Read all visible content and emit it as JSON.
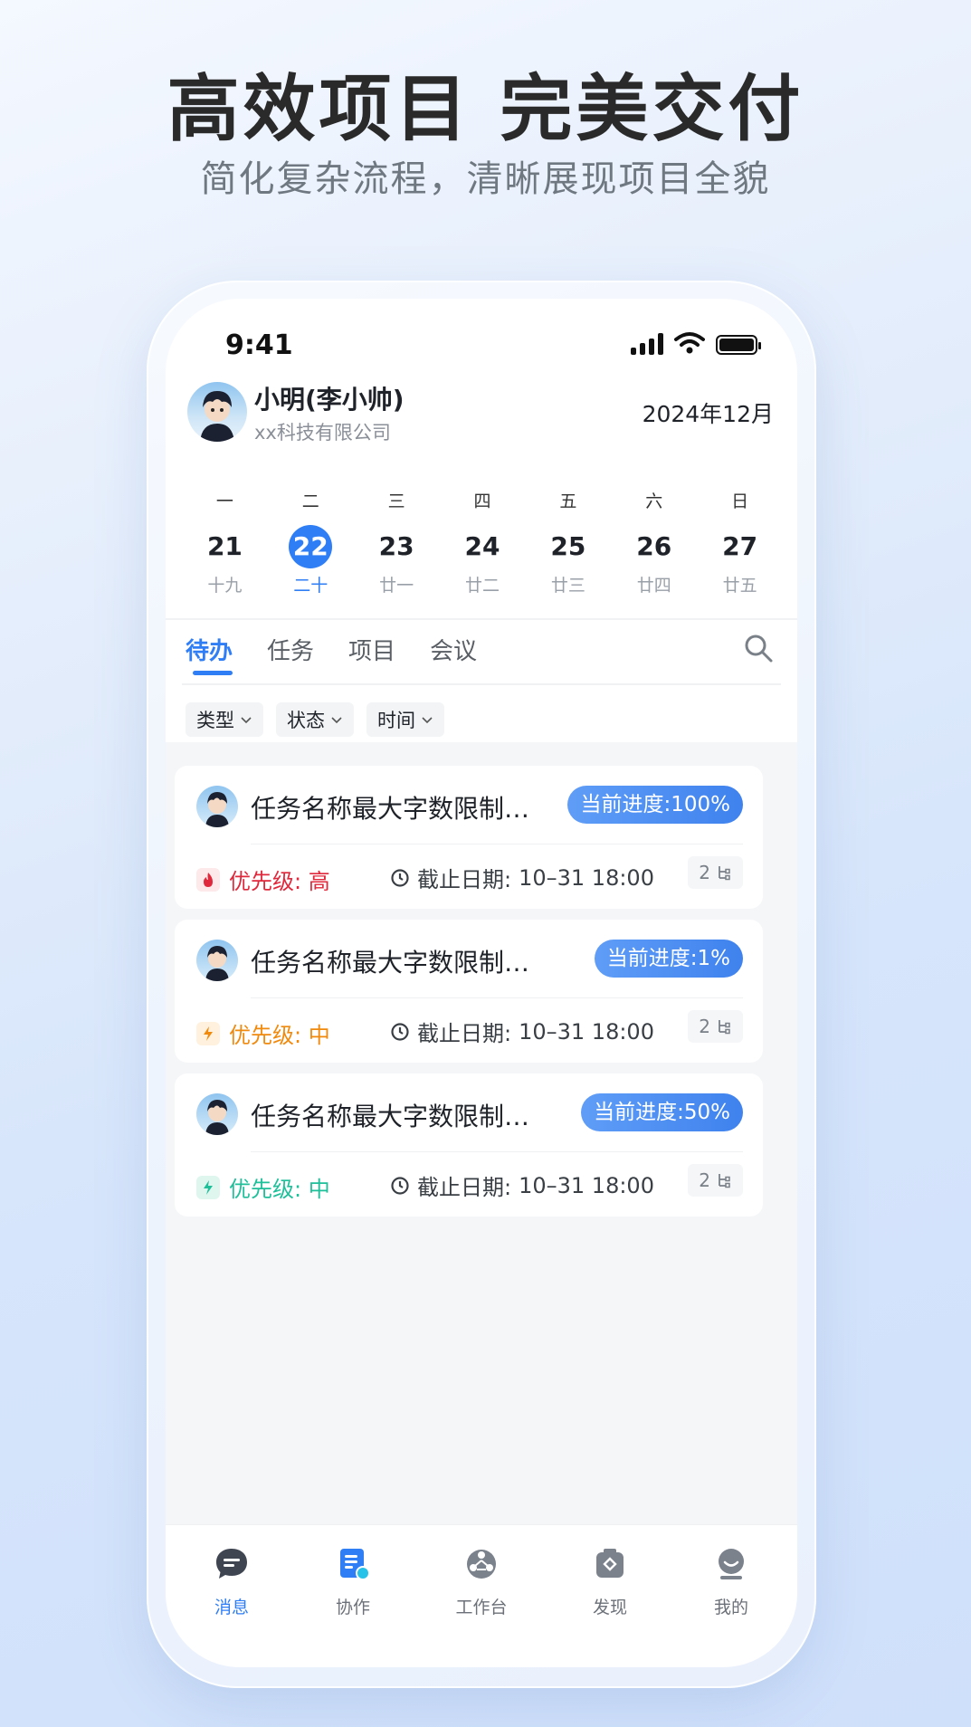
{
  "hero": {
    "title": "高效项目 完美交付",
    "subtitle": "简化复杂流程，清晰展现项目全貌"
  },
  "status_bar": {
    "time": "9:41"
  },
  "header": {
    "user_name": "小明(李小帅)",
    "company": "xx科技有限公司",
    "month": "2024年12月"
  },
  "calendar": {
    "days": [
      {
        "weekday": "一",
        "date": "21",
        "lunar": "十九",
        "selected": false
      },
      {
        "weekday": "二",
        "date": "22",
        "lunar": "二十",
        "selected": true
      },
      {
        "weekday": "三",
        "date": "23",
        "lunar": "廿一",
        "selected": false
      },
      {
        "weekday": "四",
        "date": "24",
        "lunar": "廿二",
        "selected": false
      },
      {
        "weekday": "五",
        "date": "25",
        "lunar": "廿三",
        "selected": false
      },
      {
        "weekday": "六",
        "date": "26",
        "lunar": "廿四",
        "selected": false
      },
      {
        "weekday": "日",
        "date": "27",
        "lunar": "廿五",
        "selected": false
      }
    ]
  },
  "tabs": [
    {
      "label": "待办",
      "active": true
    },
    {
      "label": "任务",
      "active": false
    },
    {
      "label": "项目",
      "active": false
    },
    {
      "label": "会议",
      "active": false
    }
  ],
  "filters": [
    {
      "label": "类型"
    },
    {
      "label": "状态"
    },
    {
      "label": "时间"
    }
  ],
  "tasks": [
    {
      "title": "任务名称最大字数限制…",
      "progress_label": "当前进度:100%",
      "progress": 1.0,
      "priority_label": "优先级: 高",
      "priority_color": "#e0283c",
      "priority_bg": "#fde8ea",
      "priority_icon": "flame-icon",
      "due_label": "截止日期:",
      "due": "10–31 18:00",
      "subtasks": "2"
    },
    {
      "title": "任务名称最大字数限制…",
      "progress_label": "当前进度:1%",
      "progress": 0.01,
      "priority_label": "优先级: 中",
      "priority_color": "#f08a0e",
      "priority_bg": "#fff1dd",
      "priority_icon": "lightning-icon",
      "due_label": "截止日期:",
      "due": "10–31 18:00",
      "subtasks": "2"
    },
    {
      "title": "任务名称最大字数限制…",
      "progress_label": "当前进度:50%",
      "progress": 0.5,
      "priority_label": "优先级: 中",
      "priority_color": "#1fbf9a",
      "priority_bg": "#dff6ef",
      "priority_icon": "lightning-icon",
      "due_label": "截止日期:",
      "due": "10–31 18:00",
      "subtasks": "2"
    }
  ],
  "bottom_nav": [
    {
      "label": "消息",
      "icon": "chat-bubble-icon",
      "active": true
    },
    {
      "label": "协作",
      "icon": "notebook-icon",
      "active": false
    },
    {
      "label": "工作台",
      "icon": "apps-icon",
      "active": false
    },
    {
      "label": "发现",
      "icon": "discover-icon",
      "active": false
    },
    {
      "label": "我的",
      "icon": "profile-icon",
      "active": false
    }
  ],
  "colors": {
    "accent": "#2f7ef5"
  }
}
